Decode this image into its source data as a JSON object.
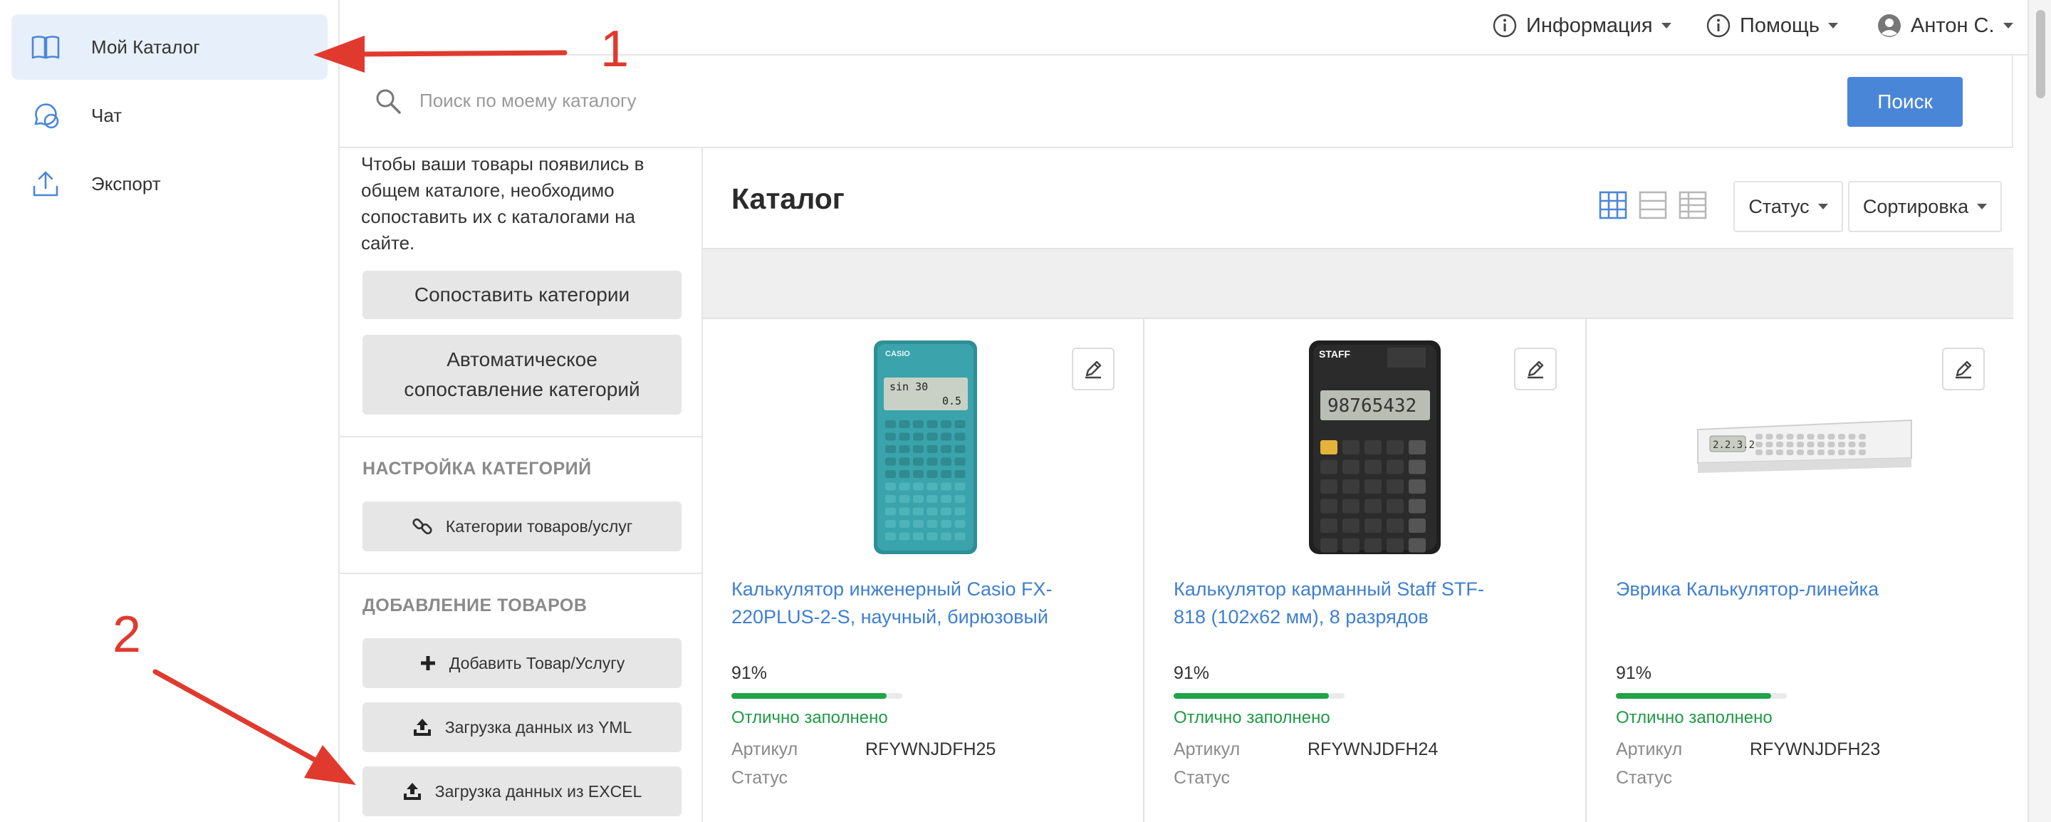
{
  "nav": {
    "items": [
      {
        "label": "Мой Каталог",
        "icon": "book-icon",
        "active": true
      },
      {
        "label": "Чат",
        "icon": "chat-icon",
        "active": false
      },
      {
        "label": "Экспорт",
        "icon": "upload-icon",
        "active": false
      }
    ]
  },
  "topbar": {
    "info_label": "Информация",
    "help_label": "Помощь",
    "user_label": "Антон С."
  },
  "search": {
    "placeholder": "Поиск по моему каталогу",
    "button_label": "Поиск"
  },
  "sidebar": {
    "info_text": "Чтобы ваши товары появились в общем каталоге, необходимо сопоставить их с каталогами на сайте.",
    "match_button": "Сопоставить категории",
    "auto_match_button": "Автоматическое сопоставление категорий",
    "section_categories": "НАСТРОЙКА КАТЕГОРИЙ",
    "categories_button": "Категории товаров/услуг",
    "section_add": "ДОБАВЛЕНИЕ ТОВАРОВ",
    "add_button": "Добавить Товар/Услугу",
    "yml_button": "Загрузка данных из YML",
    "excel_button": "Загрузка данных из EXCEL"
  },
  "main": {
    "title": "Каталог",
    "status_dropdown": "Статус",
    "sort_dropdown": "Сортировка",
    "active_view": "grid",
    "article_label": "Артикул",
    "status_label": "Статус",
    "colors": {
      "link": "#3f7fcf",
      "progress": "#21a34a",
      "primary": "#4a86d8"
    }
  },
  "products": [
    {
      "title": "Калькулятор инженерный Casio FX-220PLUS-2-S, научный, бирюзовый",
      "percent": "91%",
      "fill": 0.91,
      "quality": "Отлично заполнено",
      "article": "RFYWNJDFH25",
      "status": ""
    },
    {
      "title": "Калькулятор карманный Staff STF-818 (102x62 мм), 8 разрядов",
      "percent": "91%",
      "fill": 0.91,
      "quality": "Отлично заполнено",
      "article": "RFYWNJDFH24",
      "status": ""
    },
    {
      "title": "Эврика Калькулятор-линейка",
      "percent": "91%",
      "fill": 0.91,
      "quality": "Отлично заполнено",
      "article": "RFYWNJDFH23",
      "status": ""
    }
  ],
  "calc_screens": {
    "casio_line1": "sin 30",
    "casio_line2": "0.5",
    "staff_display": "98765432",
    "ruler_display": "2.2.3.2"
  },
  "annotations": {
    "label_1": "1",
    "label_2": "2",
    "color": "#e03a2f"
  }
}
